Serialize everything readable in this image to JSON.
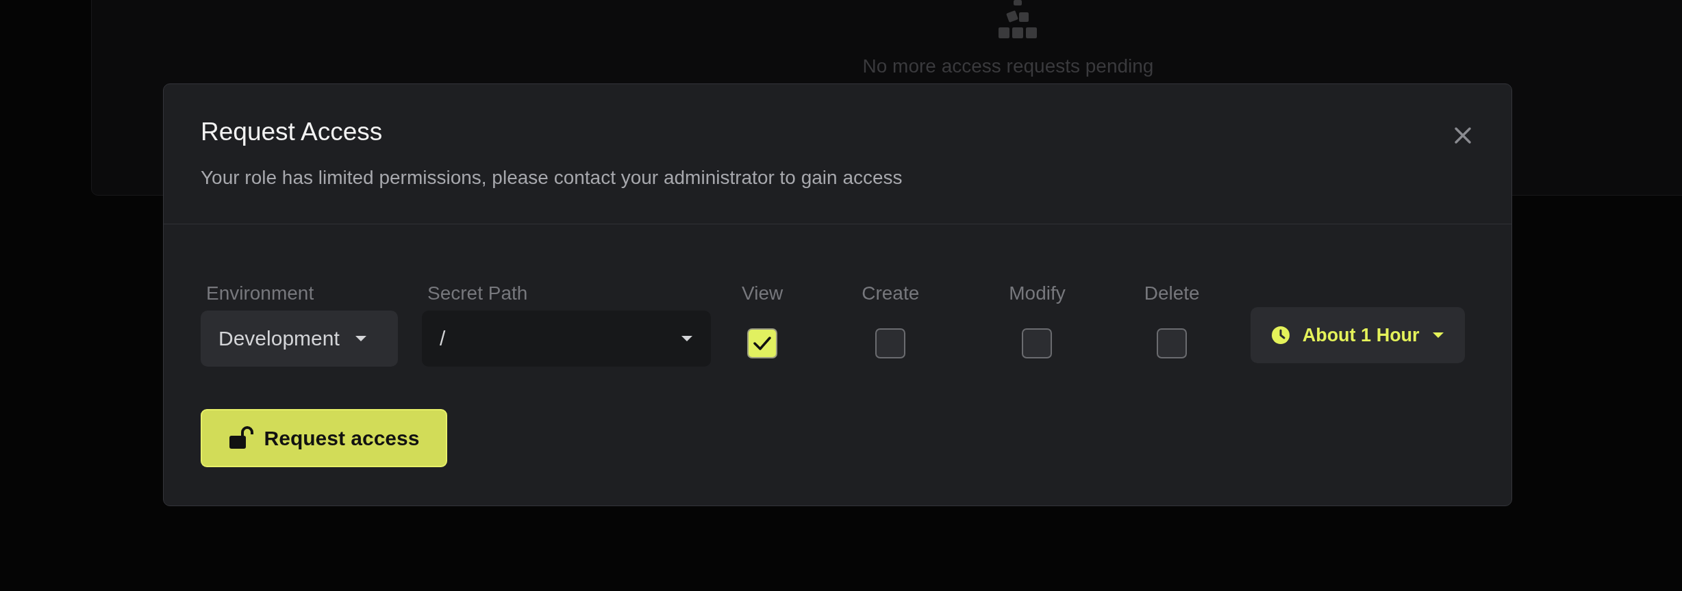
{
  "background": {
    "message": "No more access requests pending"
  },
  "modal": {
    "title": "Request Access",
    "subtitle": "Your role has limited permissions, please contact your administrator to gain access",
    "fields": [
      {
        "label": "Environment",
        "value": "Development",
        "kind": "select"
      },
      {
        "label": "Secret Path",
        "value": "/",
        "kind": "path"
      }
    ],
    "permissions": [
      {
        "label": "View",
        "checked": true
      },
      {
        "label": "Create",
        "checked": false
      },
      {
        "label": "Modify",
        "checked": false
      },
      {
        "label": "Delete",
        "checked": false
      }
    ],
    "duration": {
      "value": "About 1 Hour"
    },
    "submit": {
      "label": "Request access"
    }
  }
}
